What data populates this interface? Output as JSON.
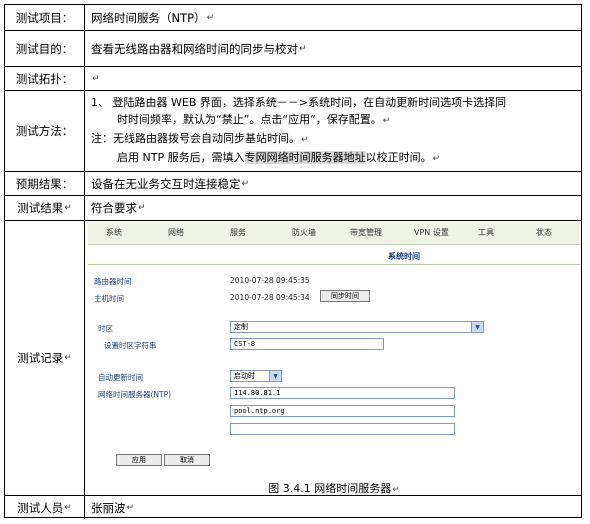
{
  "rows": {
    "item": {
      "label": "测试项目：",
      "value": "网络时间服务（NTP）"
    },
    "purpose": {
      "label": "测试目的：",
      "value": "查看无线路由器和网络时间的同步与校对"
    },
    "topology": {
      "label": "测试拓扑：",
      "value": ""
    },
    "method": {
      "label": "测试方法：",
      "line1": "1、 登陆路由器 WEB 界面，选择系统－－>系统时间，在自动更新时间选项卡选择同",
      "line2": "时时间频率，默认为“禁止”。点击“应用”，保存配置。",
      "line3": "注：无线路由器拨号会自动同步基站时间。",
      "line4a": "启用 NTP 服务后，需填入",
      "line4b": "专网网络时间服务器地址",
      "line4c": "以校正时间。"
    },
    "expected": {
      "label": "预期结果：",
      "value": "设备在无业务交互时连接稳定"
    },
    "result": {
      "label": "测试结果",
      "value": "符合要求"
    },
    "record": {
      "label": "测试记录"
    },
    "tester": {
      "label": "测试人员",
      "value": "张丽波"
    }
  },
  "paragraph_mark": "↵",
  "router": {
    "nav": [
      "系统",
      "网络",
      "服务",
      "防火墙",
      "带宽管理",
      "VPN 设置",
      "工具",
      "状态"
    ],
    "page_title": "系统时间",
    "router_time_label": "路由器时间",
    "router_time_value": "2010-07-28 09:45:35",
    "host_time_label": "主机时间",
    "host_time_value": "2010-07-28 09:45:34",
    "sync_button": "同步时间",
    "timezone_label": "时区",
    "timezone_value": "定制",
    "tz_string_label": "设置时区字符串",
    "tz_string_value": "CST-8",
    "auto_update_label": "自动更新时间",
    "auto_update_value": "启动时",
    "ntp_label": "网络时间服务器(NTP)",
    "ntp_servers": [
      "114.80.81.1",
      "pool.ntp.org",
      ""
    ],
    "apply_button": "应用",
    "cancel_button": "取消"
  },
  "caption": "图 3.4.1 网络时间服务器"
}
